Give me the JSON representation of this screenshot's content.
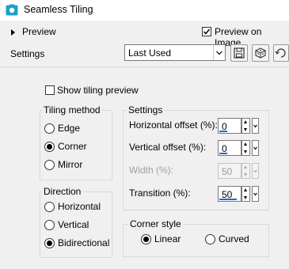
{
  "window": {
    "title": "Seamless Tiling"
  },
  "preview": {
    "label": "Preview",
    "preview_on_image_label": "Preview on Image",
    "preview_on_image_checked": true
  },
  "settings_bar": {
    "label": "Settings",
    "preset_value": "Last Used"
  },
  "show_tiling_preview": {
    "label": "Show tiling preview",
    "checked": false
  },
  "tiling_method": {
    "label": "Tiling method",
    "options": [
      {
        "label": "Edge",
        "selected": false
      },
      {
        "label": "Corner",
        "selected": true
      },
      {
        "label": "Mirror",
        "selected": false
      }
    ]
  },
  "direction": {
    "label": "Direction",
    "options": [
      {
        "label": "Horizontal",
        "selected": false
      },
      {
        "label": "Vertical",
        "selected": false
      },
      {
        "label": "Bidirectional",
        "selected": true
      }
    ]
  },
  "settings_group": {
    "label": "Settings",
    "horizontal_offset": {
      "label": "Horizontal offset (%):",
      "value": "0"
    },
    "vertical_offset": {
      "label": "Vertical offset (%):",
      "value": "0"
    },
    "width": {
      "label": "Width (%):",
      "value": "50",
      "enabled": false
    },
    "transition": {
      "label": "Transition (%):",
      "value": "50"
    }
  },
  "corner_style": {
    "label": "Corner style",
    "options": [
      {
        "label": "Linear",
        "selected": true
      },
      {
        "label": "Curved",
        "selected": false
      }
    ]
  },
  "colors": {
    "accent": "#1a6ed8",
    "icon_teal": "#1aa3c9"
  }
}
